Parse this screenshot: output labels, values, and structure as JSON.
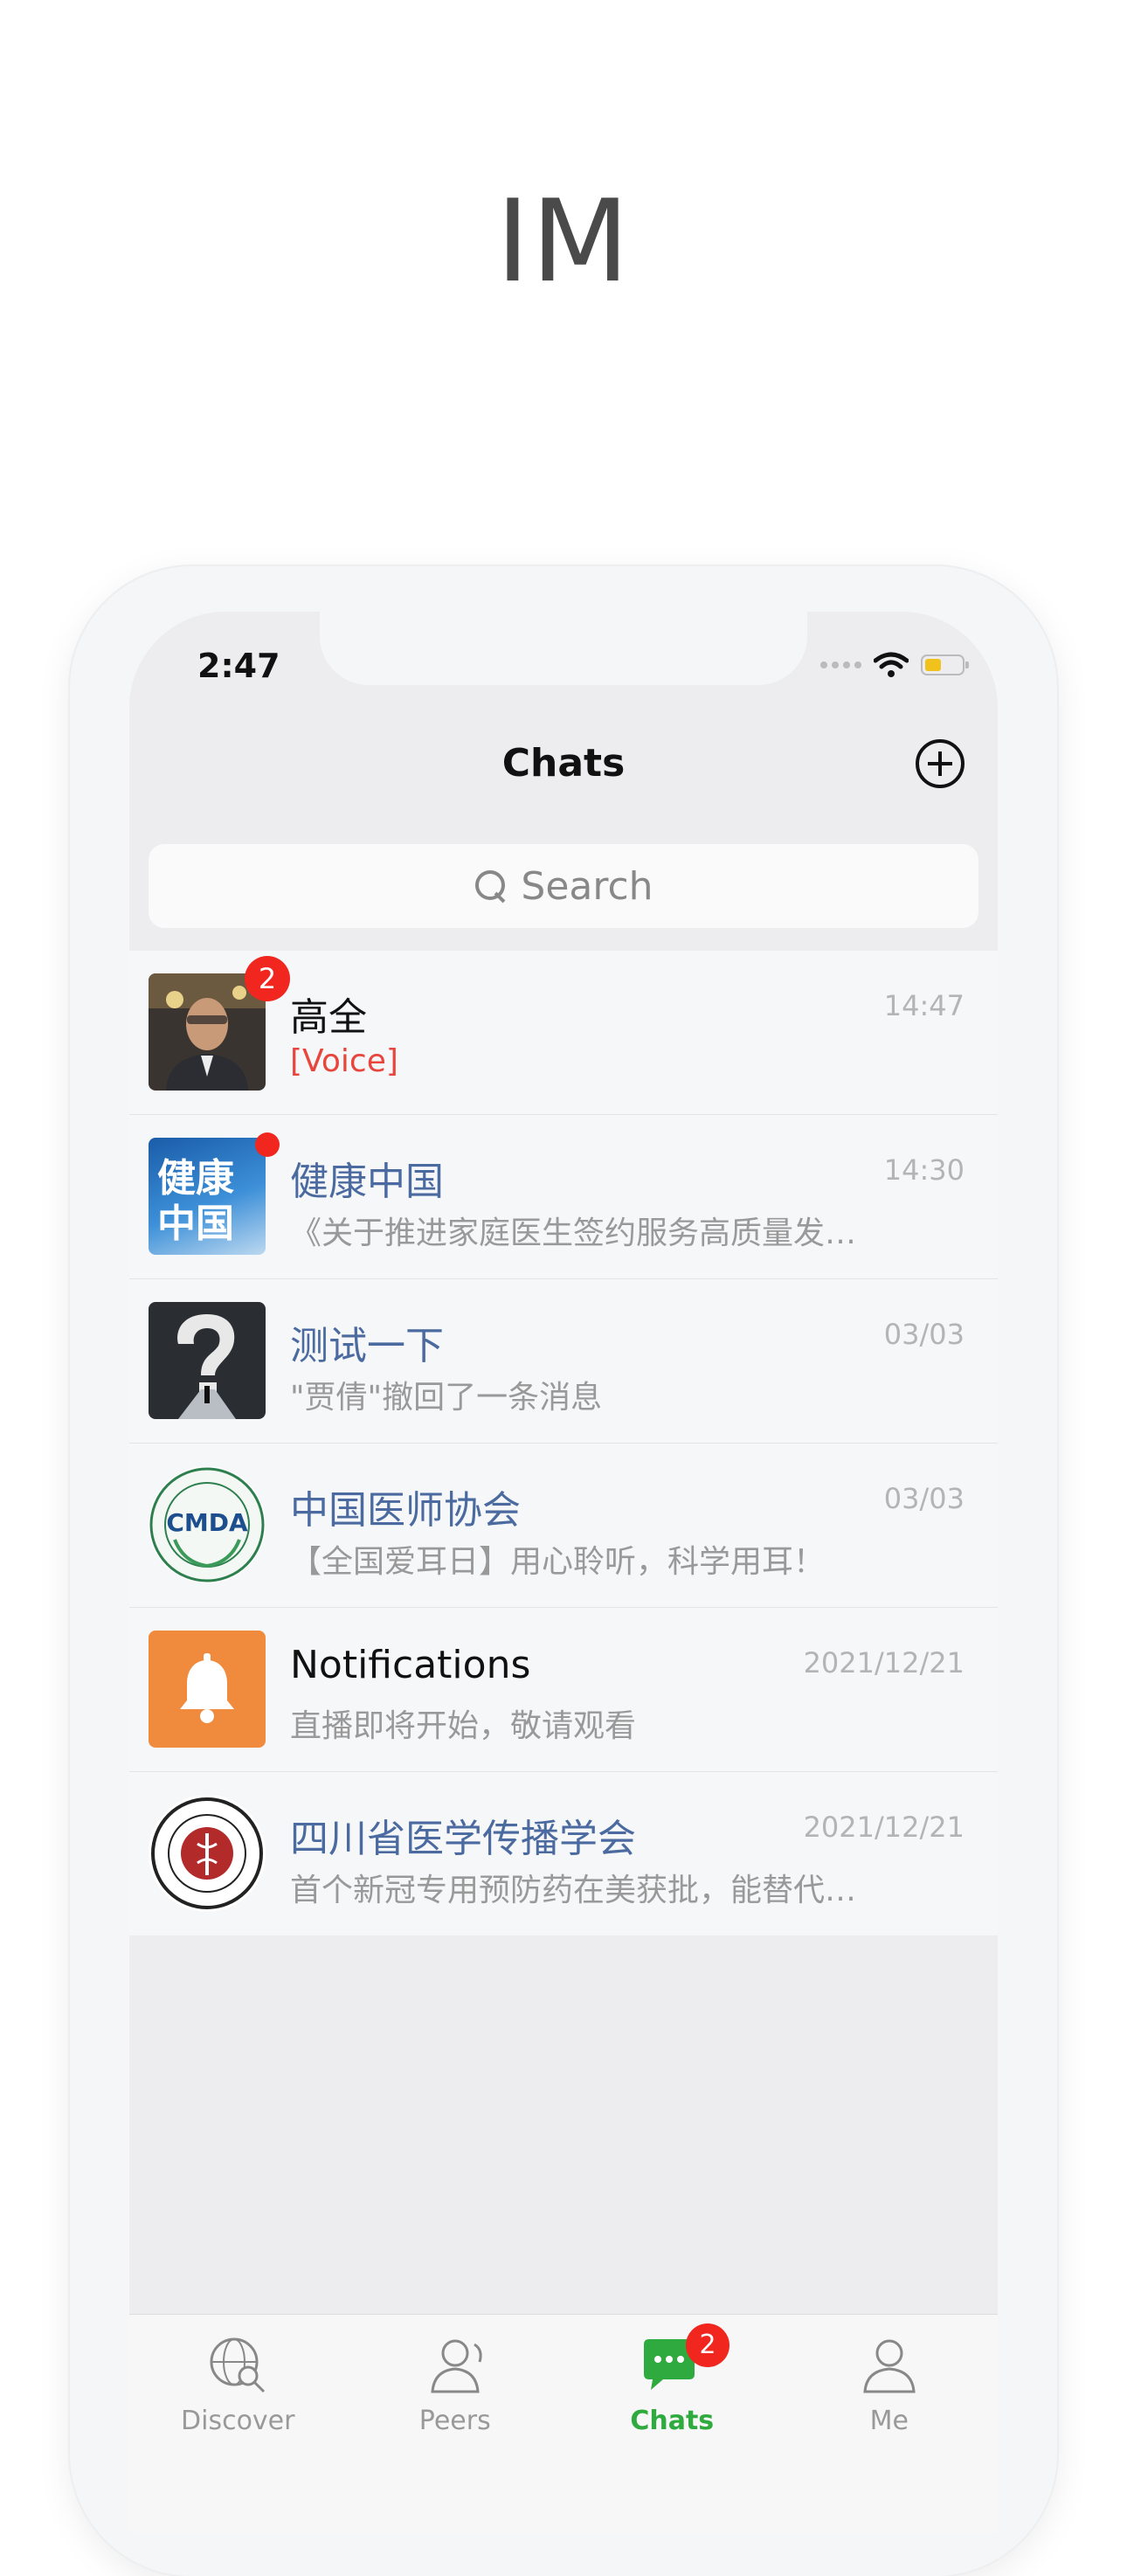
{
  "hero": {
    "title": "IM"
  },
  "status_bar": {
    "time": "2:47",
    "battery_color": "#f2c21c"
  },
  "nav": {
    "title": "Chats",
    "add_icon": "plus-circle-icon"
  },
  "search": {
    "placeholder": "Search"
  },
  "chats": [
    {
      "name": "高全",
      "time": "14:47",
      "preview": "[Voice]",
      "badge": "2",
      "avatar": "person-photo"
    },
    {
      "name": "健康中国",
      "time": "14:30",
      "preview": "《关于推进家庭医生签约服务高质量发…",
      "badge_dot": true,
      "avatar": "健康中国",
      "avatar_lines": [
        "健康",
        "中国"
      ]
    },
    {
      "name": "测试一下",
      "time": "03/03",
      "preview": "\"贾倩\"撤回了一条消息",
      "avatar": "question-mark-image"
    },
    {
      "name": "中国医师协会",
      "time": "03/03",
      "preview": "【全国爱耳日】用心聆听，科学用耳！",
      "avatar": "CMDA",
      "avatar_text": "CMDA"
    },
    {
      "name": "Notifications",
      "time": "2021/12/21",
      "preview": "直播即将开始，敬请观看",
      "avatar": "bell-icon"
    },
    {
      "name": "四川省医学传播学会",
      "time": "2021/12/21",
      "preview": "首个新冠专用预防药在美获批，能替代…",
      "avatar": "seal-logo"
    }
  ],
  "tabs": [
    {
      "label": "Discover",
      "icon": "globe-search-icon"
    },
    {
      "label": "Peers",
      "icon": "people-icon"
    },
    {
      "label": "Chats",
      "icon": "chat-bubble-icon",
      "badge": "2",
      "active": true
    },
    {
      "label": "Me",
      "icon": "person-icon"
    }
  ],
  "colors": {
    "accent_green": "#2faa3e",
    "badge_red": "#f0261f",
    "link_blue": "#4a6aa0",
    "notification_orange": "#f08a3c"
  }
}
